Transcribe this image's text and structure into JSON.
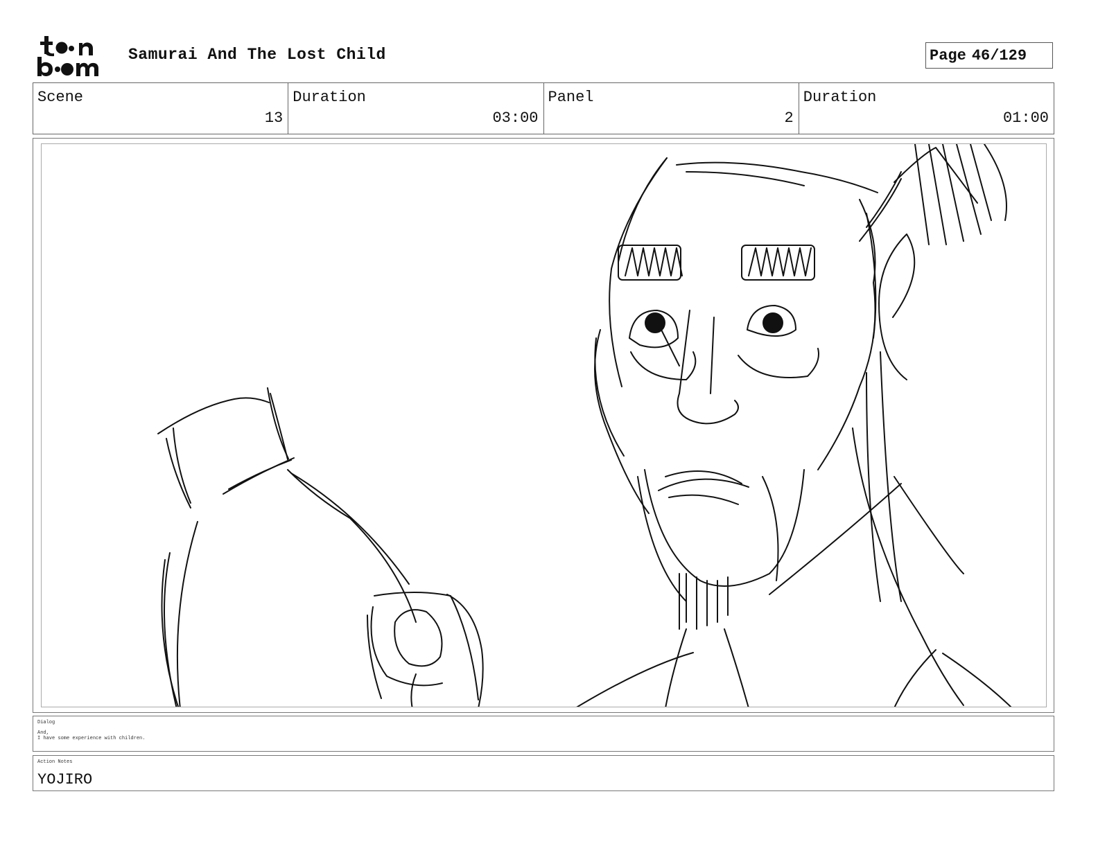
{
  "header": {
    "logo_text": "toon boom",
    "project_title": "Samurai And The Lost Child",
    "page_label": "Page",
    "page_value": "46/129"
  },
  "info": {
    "scene_label": "Scene",
    "scene_value": "13",
    "scene_duration_label": "Duration",
    "scene_duration_value": "03:00",
    "panel_label": "Panel",
    "panel_value": "2",
    "panel_duration_label": "Duration",
    "panel_duration_value": "01:00"
  },
  "dialog": {
    "label": "Dialog",
    "text": "And,\nI have some experience with children."
  },
  "action_notes": {
    "label": "Action Notes",
    "text": "YOJIRO"
  }
}
